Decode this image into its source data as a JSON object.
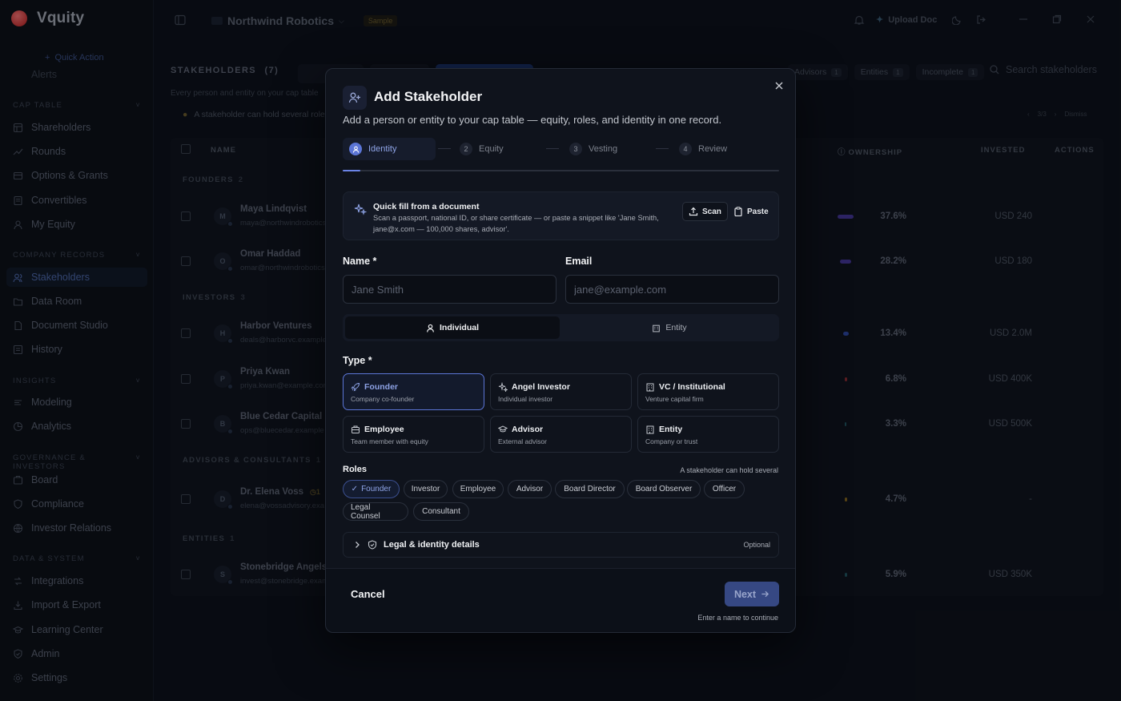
{
  "app": {
    "name": "Vquity",
    "quick_action": "Quick Action",
    "truncated_item": "Alerts"
  },
  "sidebar": {
    "sections": [
      {
        "title": "CAP TABLE",
        "items": [
          "Shareholders",
          "Rounds",
          "Options & Grants",
          "Convertibles",
          "My Equity"
        ]
      },
      {
        "title": "COMPANY RECORDS",
        "items": [
          "Stakeholders",
          "Data Room",
          "Document Studio",
          "History"
        ]
      },
      {
        "title": "INSIGHTS",
        "items": [
          "Modeling",
          "Analytics"
        ]
      },
      {
        "title": "GOVERNANCE & INVESTORS",
        "items": [
          "Board",
          "Compliance",
          "Investor Relations"
        ]
      },
      {
        "title": "DATA & SYSTEM",
        "items": [
          "Integrations",
          "Import & Export",
          "Learning Center",
          "Admin",
          "Settings"
        ]
      }
    ],
    "active_item": "Stakeholders"
  },
  "topbar": {
    "org_name": "Northwind Robotics",
    "badge": "Sample",
    "upload": "Upload Doc"
  },
  "page": {
    "title": "STAKEHOLDERS",
    "count": "(7)",
    "subtitle": "Every person and entity on your cap table",
    "hint": "A stakeholder can hold several roles",
    "search_placeholder": "Search stakeholders",
    "pager": "3/3",
    "dismiss": "Dismiss",
    "filters": [
      {
        "label": "Advisors",
        "count": "1"
      },
      {
        "label": "Entities",
        "count": "1"
      },
      {
        "label": "Incomplete",
        "count": "1"
      }
    ],
    "columns": {
      "name": "NAME",
      "ownership": "OWNERSHIP",
      "invested": "INVESTED",
      "actions": "ACTIONS"
    },
    "groups": [
      {
        "label": "FOUNDERS",
        "count": "2"
      },
      {
        "label": "INVESTORS",
        "count": "3"
      },
      {
        "label": "ADVISORS & CONSULTANTS",
        "count": "1"
      },
      {
        "label": "ENTITIES",
        "count": "1"
      }
    ],
    "rows": [
      {
        "initial": "M",
        "name": "Maya Lindqvist",
        "email": "maya@northwindrobotics",
        "ownership": "37.6%",
        "invested": "USD 240",
        "bar_color": "#5b45c9"
      },
      {
        "initial": "O",
        "name": "Omar Haddad",
        "email": "omar@northwindrobotics",
        "ownership": "28.2%",
        "invested": "USD 180",
        "bar_color": "#5b45c9"
      },
      {
        "initial": "H",
        "name": "Harbor Ventures",
        "email": "deals@harborvc.example",
        "ownership": "13.4%",
        "invested": "USD 2.0M",
        "bar_color": "#3b5bd6"
      },
      {
        "initial": "P",
        "name": "Priya Kwan",
        "email": "priya.kwan@example.com",
        "ownership": "6.8%",
        "invested": "USD 400K",
        "bar_color": "#c0343a"
      },
      {
        "initial": "B",
        "name": "Blue Cedar Capital",
        "email": "ops@bluecedar.example",
        "ownership": "3.3%",
        "invested": "USD 500K",
        "bar_color": "#2a6f7a"
      },
      {
        "initial": "D",
        "name": "Dr. Elena Voss",
        "email": "elena@vossadvisory.exa",
        "ownership": "4.7%",
        "invested": "-",
        "bar_color": "#b88a1c",
        "badge": "1"
      },
      {
        "initial": "S",
        "name": "Stonebridge Angels L",
        "email": "invest@stonebridge.exam",
        "ownership": "5.9%",
        "invested": "USD 350K",
        "bar_color": "#2a6f7a"
      }
    ]
  },
  "modal": {
    "title": "Add Stakeholder",
    "subtitle": "Add a person or entity to your cap table — equity, roles, and identity in one record.",
    "steps": [
      {
        "num": "1",
        "label": "Identity"
      },
      {
        "num": "2",
        "label": "Equity"
      },
      {
        "num": "3",
        "label": "Vesting"
      },
      {
        "num": "4",
        "label": "Review"
      }
    ],
    "progress": 0.04,
    "quickfill": {
      "title": "Quick fill from a document",
      "text": "Scan a passport, national ID, or share certificate — or paste a snippet like 'Jane Smith, jane@x.com — 100,000 shares, advisor'.",
      "scan": "Scan",
      "paste": "Paste"
    },
    "name_label": "Name *",
    "name_placeholder": "Jane Smith",
    "email_label": "Email",
    "email_placeholder": "jane@example.com",
    "kind": {
      "individual": "Individual",
      "entity": "Entity",
      "selected": "Individual"
    },
    "type_label": "Type *",
    "types": [
      {
        "name": "Founder",
        "desc": "Company co-founder",
        "icon": "rocket-icon",
        "selected": true
      },
      {
        "name": "Angel Investor",
        "desc": "Individual investor",
        "icon": "sparkles-icon",
        "selected": false
      },
      {
        "name": "VC / Institutional",
        "desc": "Venture capital firm",
        "icon": "building-icon",
        "selected": false
      },
      {
        "name": "Employee",
        "desc": "Team member with equity",
        "icon": "briefcase-icon",
        "selected": false
      },
      {
        "name": "Advisor",
        "desc": "External advisor",
        "icon": "graduation-cap-icon",
        "selected": false
      },
      {
        "name": "Entity",
        "desc": "Company or trust",
        "icon": "building-icon",
        "selected": false
      }
    ],
    "roles_label": "Roles",
    "roles_hint": "A stakeholder can hold several",
    "roles": [
      "Founder",
      "Investor",
      "Employee",
      "Advisor",
      "Board Director",
      "Board Observer",
      "Officer",
      "Legal Counsel",
      "Consultant"
    ],
    "selected_roles": [
      "Founder"
    ],
    "legal": {
      "label": "Legal & identity details",
      "optional": "Optional"
    },
    "cancel": "Cancel",
    "next": "Next",
    "next_hint": "Enter a name to continue"
  }
}
